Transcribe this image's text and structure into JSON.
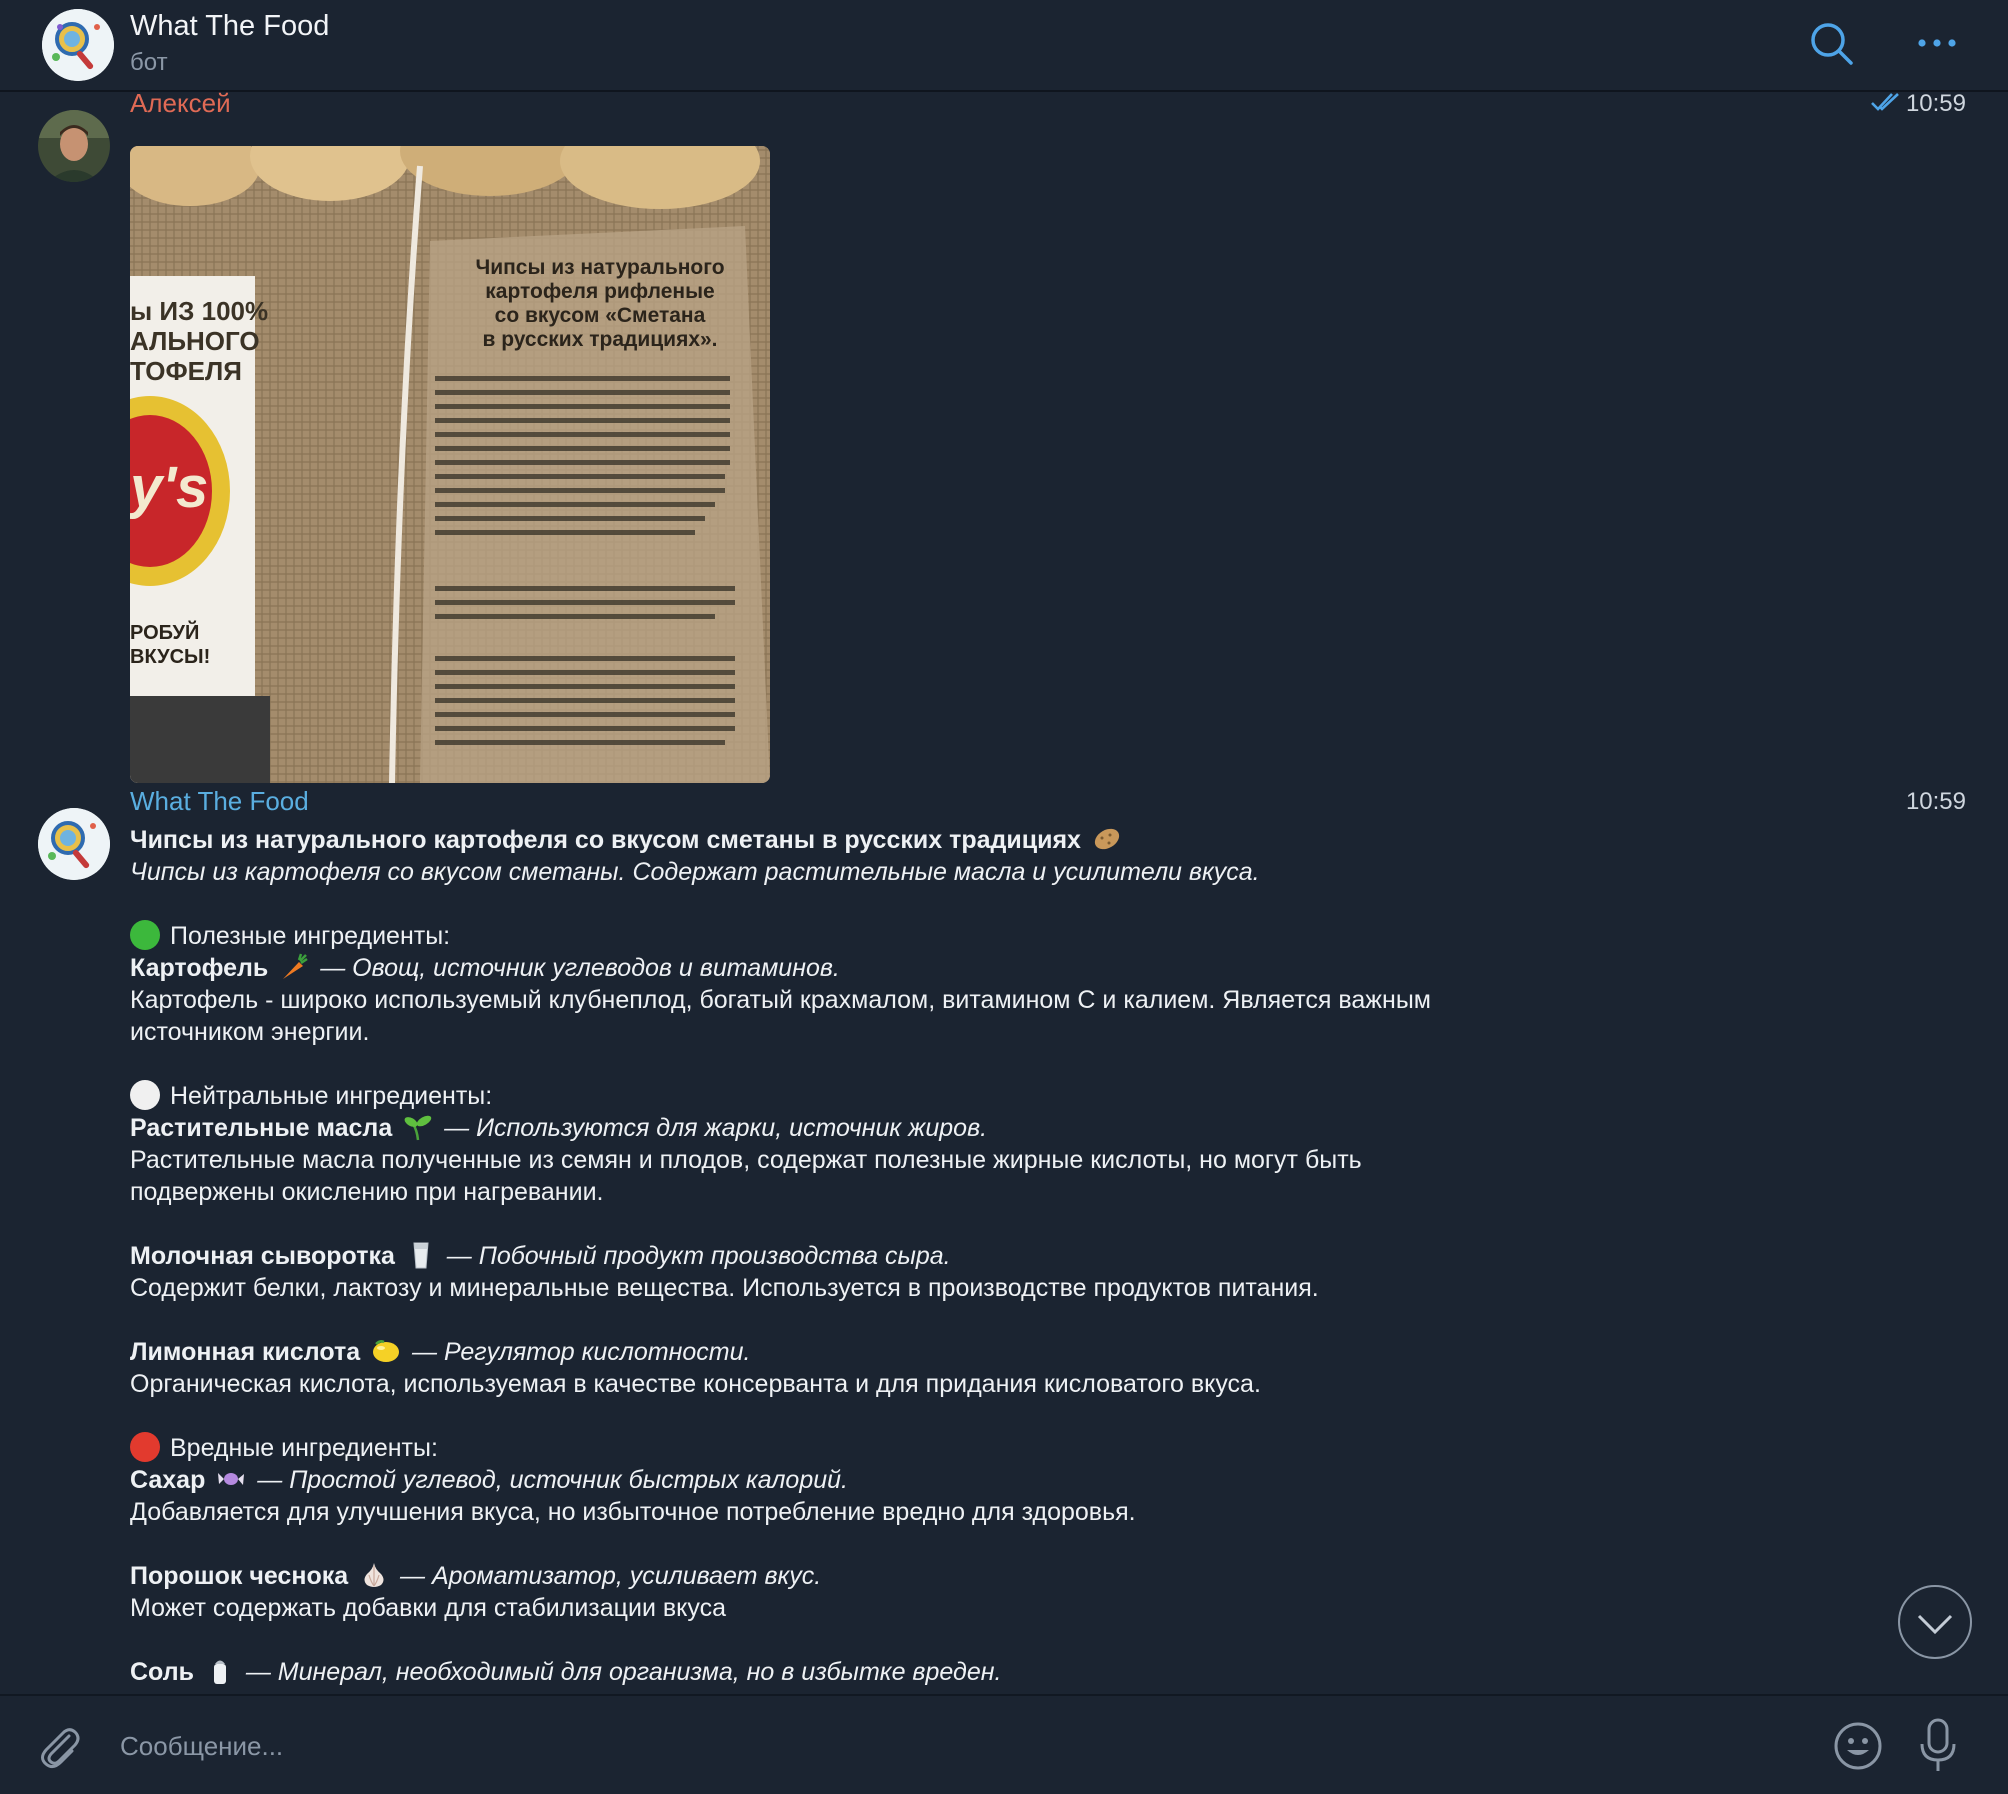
{
  "header": {
    "title": "What The Food",
    "subtitle": "бот"
  },
  "messages": {
    "user": {
      "sender": "Алексей",
      "time": "10:59",
      "sender_color": "#e06a55",
      "photo_text": {
        "left_lines": [
          "ы ИЗ 100%",
          "АЛЬНОГО",
          "ТОФЕЛЯ"
        ],
        "brand": "y's",
        "left_bottom": [
          "РОБУЙ",
          "ВКУСЫ!"
        ],
        "title_lines": [
          "Чипсы из натурального",
          "картофеля рифленые",
          "со вкусом «Сметана",
          "в русских традициях»."
        ]
      }
    },
    "bot": {
      "sender": "What The Food",
      "time": "10:59",
      "sender_color": "#5aaee0",
      "title": "Чипсы из натурального картофеля со вкусом сметаны в русских традициях",
      "summary": "Чипсы из картофеля со вкусом сметаны. Содержат растительные масла и усилители вкуса.",
      "good_header": "Полезные ингредиенты:",
      "good": [
        {
          "name": "Картофель",
          "note": "— Овощ, источник углеводов и витаминов.",
          "desc": "Картофель - широко используемый клубнеплод, богатый крахмалом, витамином С и калием. Является важным источником энергии.",
          "icon": "carrot-icon"
        }
      ],
      "neutral_header": "Нейтральные ингредиенты:",
      "neutral": [
        {
          "name": "Растительные масла",
          "note": "— Используются для жарки, источник жиров.",
          "desc": "Растительные масла полученные из семян и плодов, содержат полезные жирные кислоты, но могут быть подвержены окислению при нагревании.",
          "icon": "seedling-icon"
        },
        {
          "name": "Молочная сыворотка",
          "note": "— Побочный продукт производства сыра.",
          "desc": "Содержит белки, лактозу и минеральные вещества. Используется в производстве продуктов питания.",
          "icon": "milk-glass-icon"
        },
        {
          "name": "Лимонная кислота",
          "note": "— Регулятор кислотности.",
          "desc": "Органическая кислота, используемая в качестве консерванта и для придания кисловатого вкуса.",
          "icon": "lemon-icon"
        }
      ],
      "bad_header": "Вредные ингредиенты:",
      "bad": [
        {
          "name": "Сахар",
          "note": "— Простой углевод, источник быстрых калорий.",
          "desc": "Добавляется для улучшения вкуса, но избыточное потребление вредно для здоровья.",
          "icon": "candy-icon"
        },
        {
          "name": "Порошок чеснока",
          "note": "— Ароматизатор, усиливает вкус.",
          "desc": "Может содержать добавки для стабилизации вкуса",
          "icon": "garlic-icon"
        },
        {
          "name": "Соль",
          "note": "— Минерал, необходимый для организма, но в избытке вреден.",
          "desc": "",
          "icon": "salt-icon"
        }
      ]
    }
  },
  "input": {
    "placeholder": "Сообщение..."
  },
  "colors": {
    "background": "#1b2431",
    "accent": "#4ea4e8",
    "good_dot": "#3cb83c",
    "neutral_dot": "#f0f0f0",
    "bad_dot": "#e23a2e"
  }
}
